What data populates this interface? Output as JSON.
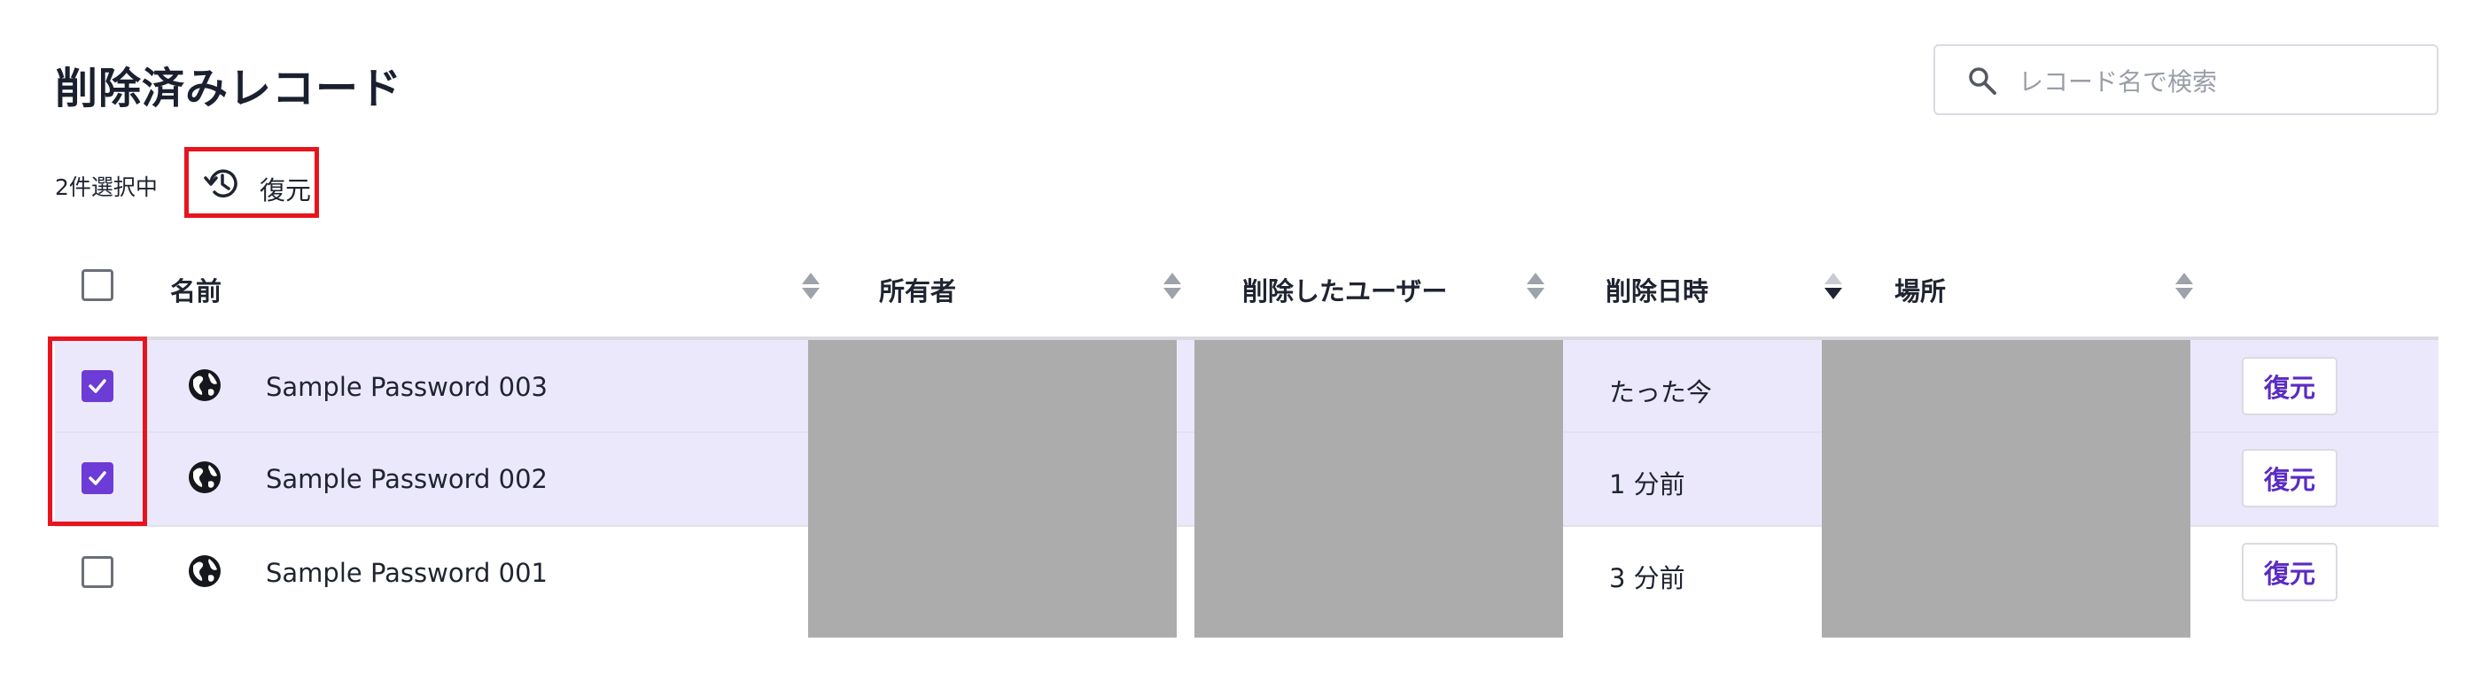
{
  "page": {
    "title": "削除済みレコード"
  },
  "search": {
    "placeholder": "レコード名で検索",
    "value": ""
  },
  "selection": {
    "count_text": "2件選択中",
    "restore_label": "復元"
  },
  "table": {
    "columns": [
      {
        "key": "name",
        "label": "名前",
        "sort": "none"
      },
      {
        "key": "owner",
        "label": "所有者",
        "sort": "none"
      },
      {
        "key": "deleted_by",
        "label": "削除したユーザー",
        "sort": "none"
      },
      {
        "key": "deleted_at",
        "label": "削除日時",
        "sort": "descending"
      },
      {
        "key": "location",
        "label": "場所",
        "sort": "none"
      }
    ],
    "rows": [
      {
        "name": "Sample Password 003",
        "deleted_at": "たった今",
        "checked": true,
        "restore_label": "復元"
      },
      {
        "name": "Sample Password 002",
        "deleted_at": "1 分前",
        "checked": true,
        "restore_label": "復元"
      },
      {
        "name": "Sample Password 001",
        "deleted_at": "3 分前",
        "checked": false,
        "restore_label": "復元"
      }
    ]
  },
  "colors": {
    "accent": "#6d3bd6",
    "selected_row": "#ece8fb",
    "redaction": "#acacac",
    "highlight": "#e8141d"
  }
}
